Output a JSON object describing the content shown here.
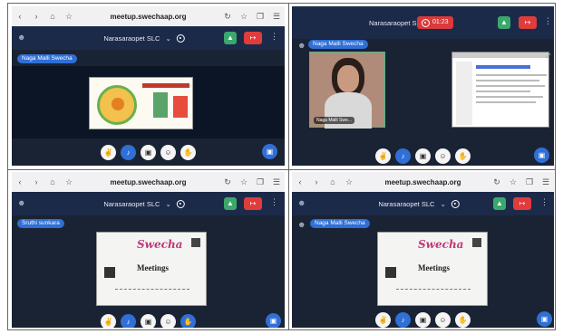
{
  "browser": {
    "url": "meetup.swechaap.org"
  },
  "meeting": {
    "room_name": "Narasaraopet SLC",
    "recording_time": "01:23"
  },
  "panels": [
    {
      "speaker": "Naga Malli Swecha"
    },
    {
      "speaker": "Naga Malli Swecha",
      "camera_name": "Naga Malli Swe..."
    },
    {
      "speaker": "Sruthi sunkara",
      "slide_title": "Meetings",
      "brand": "Swecha"
    },
    {
      "speaker": "Naga Malli Swecha",
      "slide_title": "Meetings",
      "brand": "Swecha"
    }
  ],
  "icons": {
    "back": "chevron-left-icon",
    "forward": "chevron-right-icon",
    "home": "home-icon",
    "star": "star-icon",
    "reload": "reload-icon",
    "tabs": "tabs-icon",
    "menu": "menu-icon",
    "users": "users-icon",
    "connection": "connection-icon",
    "leave": "leave-icon",
    "hand": "raise-hand-icon",
    "mic": "microphone-icon",
    "video": "video-icon",
    "emoji": "emoji-icon",
    "share": "screen-share-icon"
  },
  "colors": {
    "leave": "#e03c3c",
    "connection": "#3aa86b",
    "accent": "#2f6fd6",
    "header": "#1c2a4a"
  }
}
